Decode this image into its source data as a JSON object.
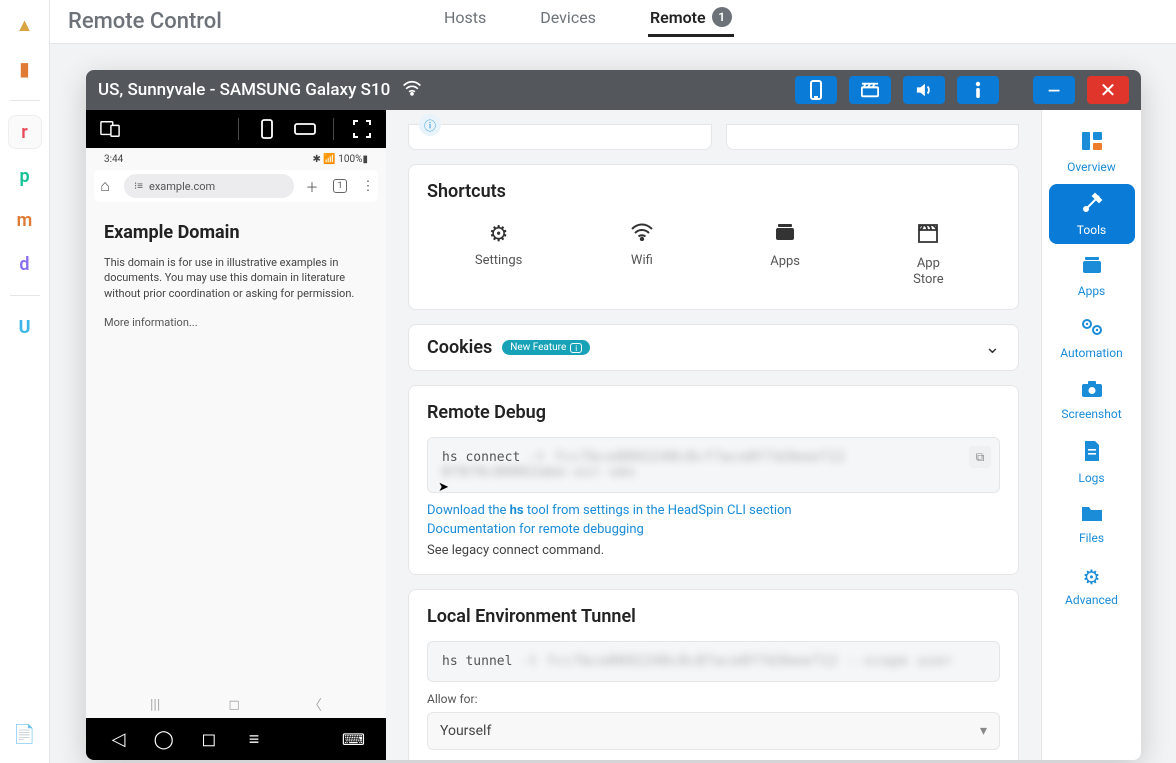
{
  "header": {
    "title": "Remote Control",
    "tabs": {
      "hosts": "Hosts",
      "devices": "Devices",
      "remote": "Remote",
      "remote_badge": "1"
    }
  },
  "left_rail": {
    "items": [
      {
        "label": "▲",
        "color": "#d9a441"
      },
      {
        "label": "▮",
        "color": "#e07b35"
      },
      {
        "label": "r",
        "color": "#e94b5a"
      },
      {
        "label": "p",
        "color": "#13c296"
      },
      {
        "label": "m",
        "color": "#e07b35"
      },
      {
        "label": "d",
        "color": "#8a6ef0"
      },
      {
        "label": "U",
        "color": "#3bb6e6"
      }
    ],
    "bottom": {
      "label": "📄",
      "color": "#e07b35"
    }
  },
  "window": {
    "title": "US, Sunnyvale - SAMSUNG Galaxy S10"
  },
  "phone": {
    "status_time": "3:44",
    "status_right": "100%",
    "url": "example.com",
    "page_title": "Example Domain",
    "page_body": "This domain is for use in illustrative examples in documents. You may use this domain in literature without prior coordination or asking for permission.",
    "more_info": "More information..."
  },
  "shortcuts": {
    "title": "Shortcuts",
    "items": {
      "settings": "Settings",
      "wifi": "Wifi",
      "apps": "Apps",
      "appstore": "App\nStore"
    }
  },
  "cookies": {
    "title": "Cookies",
    "badge": "New Feature"
  },
  "remote_debug": {
    "title": "Remote Debug",
    "cmd_prefix": "hs connect",
    "link_download_pre": "Download the ",
    "link_download_hs": "hs",
    "link_download_post": " tool from settings in the HeadSpin CLI section",
    "link_docs": "Documentation for remote debugging",
    "legacy": "See legacy connect command."
  },
  "tunnel": {
    "title": "Local Environment Tunnel",
    "cmd_prefix": "hs tunnel",
    "allow_label": "Allow for:",
    "select_value": "Yourself"
  },
  "sidebar": {
    "overview": "Overview",
    "tools": "Tools",
    "apps": "Apps",
    "automation": "Automation",
    "screenshot": "Screenshot",
    "logs": "Logs",
    "files": "Files",
    "advanced": "Advanced"
  }
}
